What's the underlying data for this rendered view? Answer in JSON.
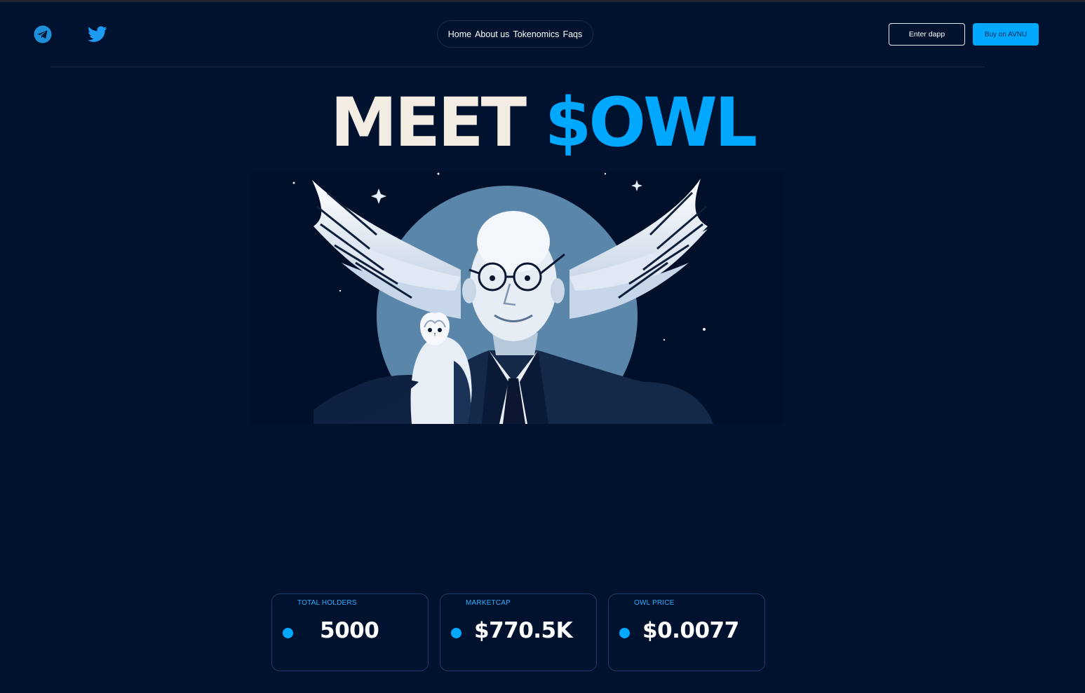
{
  "header": {
    "social": {
      "telegram_icon": "telegram-icon",
      "twitter_icon": "twitter-icon"
    },
    "nav": [
      "Home",
      "About us",
      "Tokenomics",
      "Faqs"
    ],
    "enter_dapp_label": "Enter dapp",
    "buy_label": "Buy on AVNU"
  },
  "hero": {
    "title_part1": "MEET",
    "title_part2": "$OWL",
    "image_description_icon": "bald-man-owl-wings-illustration"
  },
  "stats": [
    {
      "label": "TOTAL HOLDERS",
      "value": "5000"
    },
    {
      "label": "MARKETCAP",
      "value": "$770.5K"
    },
    {
      "label": "OWL PRICE",
      "value": "$0.0077"
    }
  ],
  "colors": {
    "background": "#01122f",
    "accent": "#00a8ff",
    "title_cream": "#f2ece2"
  }
}
